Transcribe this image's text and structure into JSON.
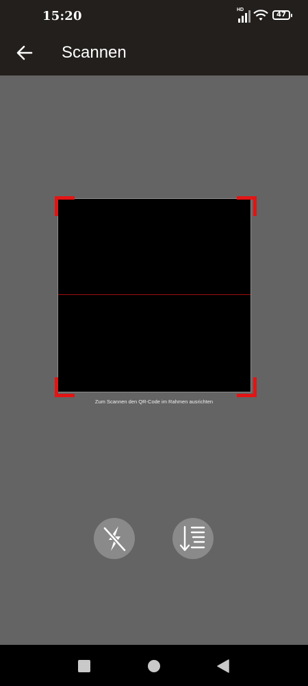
{
  "status_bar": {
    "time": "15:20",
    "network_label": "HD",
    "battery": "47",
    "icons": [
      "signal-icon",
      "wifi-icon",
      "battery-icon"
    ]
  },
  "app_bar": {
    "title": "Scannen",
    "back_icon": "arrow-left-icon"
  },
  "scanner": {
    "hint": "Zum Scannen den QR-Code im Rahmen ausrichten",
    "frame_color": "#e31414",
    "scanline_color": "#a01010"
  },
  "actions": [
    {
      "icon": "flash-off-icon"
    },
    {
      "icon": "sort-list-icon"
    }
  ],
  "nav_bar": {
    "icons": [
      "recents-square-icon",
      "home-circle-icon",
      "back-triangle-icon"
    ]
  },
  "colors": {
    "bar_background": "#221f1c",
    "screen_background": "#646464",
    "button_background": "#8a8a8a"
  }
}
